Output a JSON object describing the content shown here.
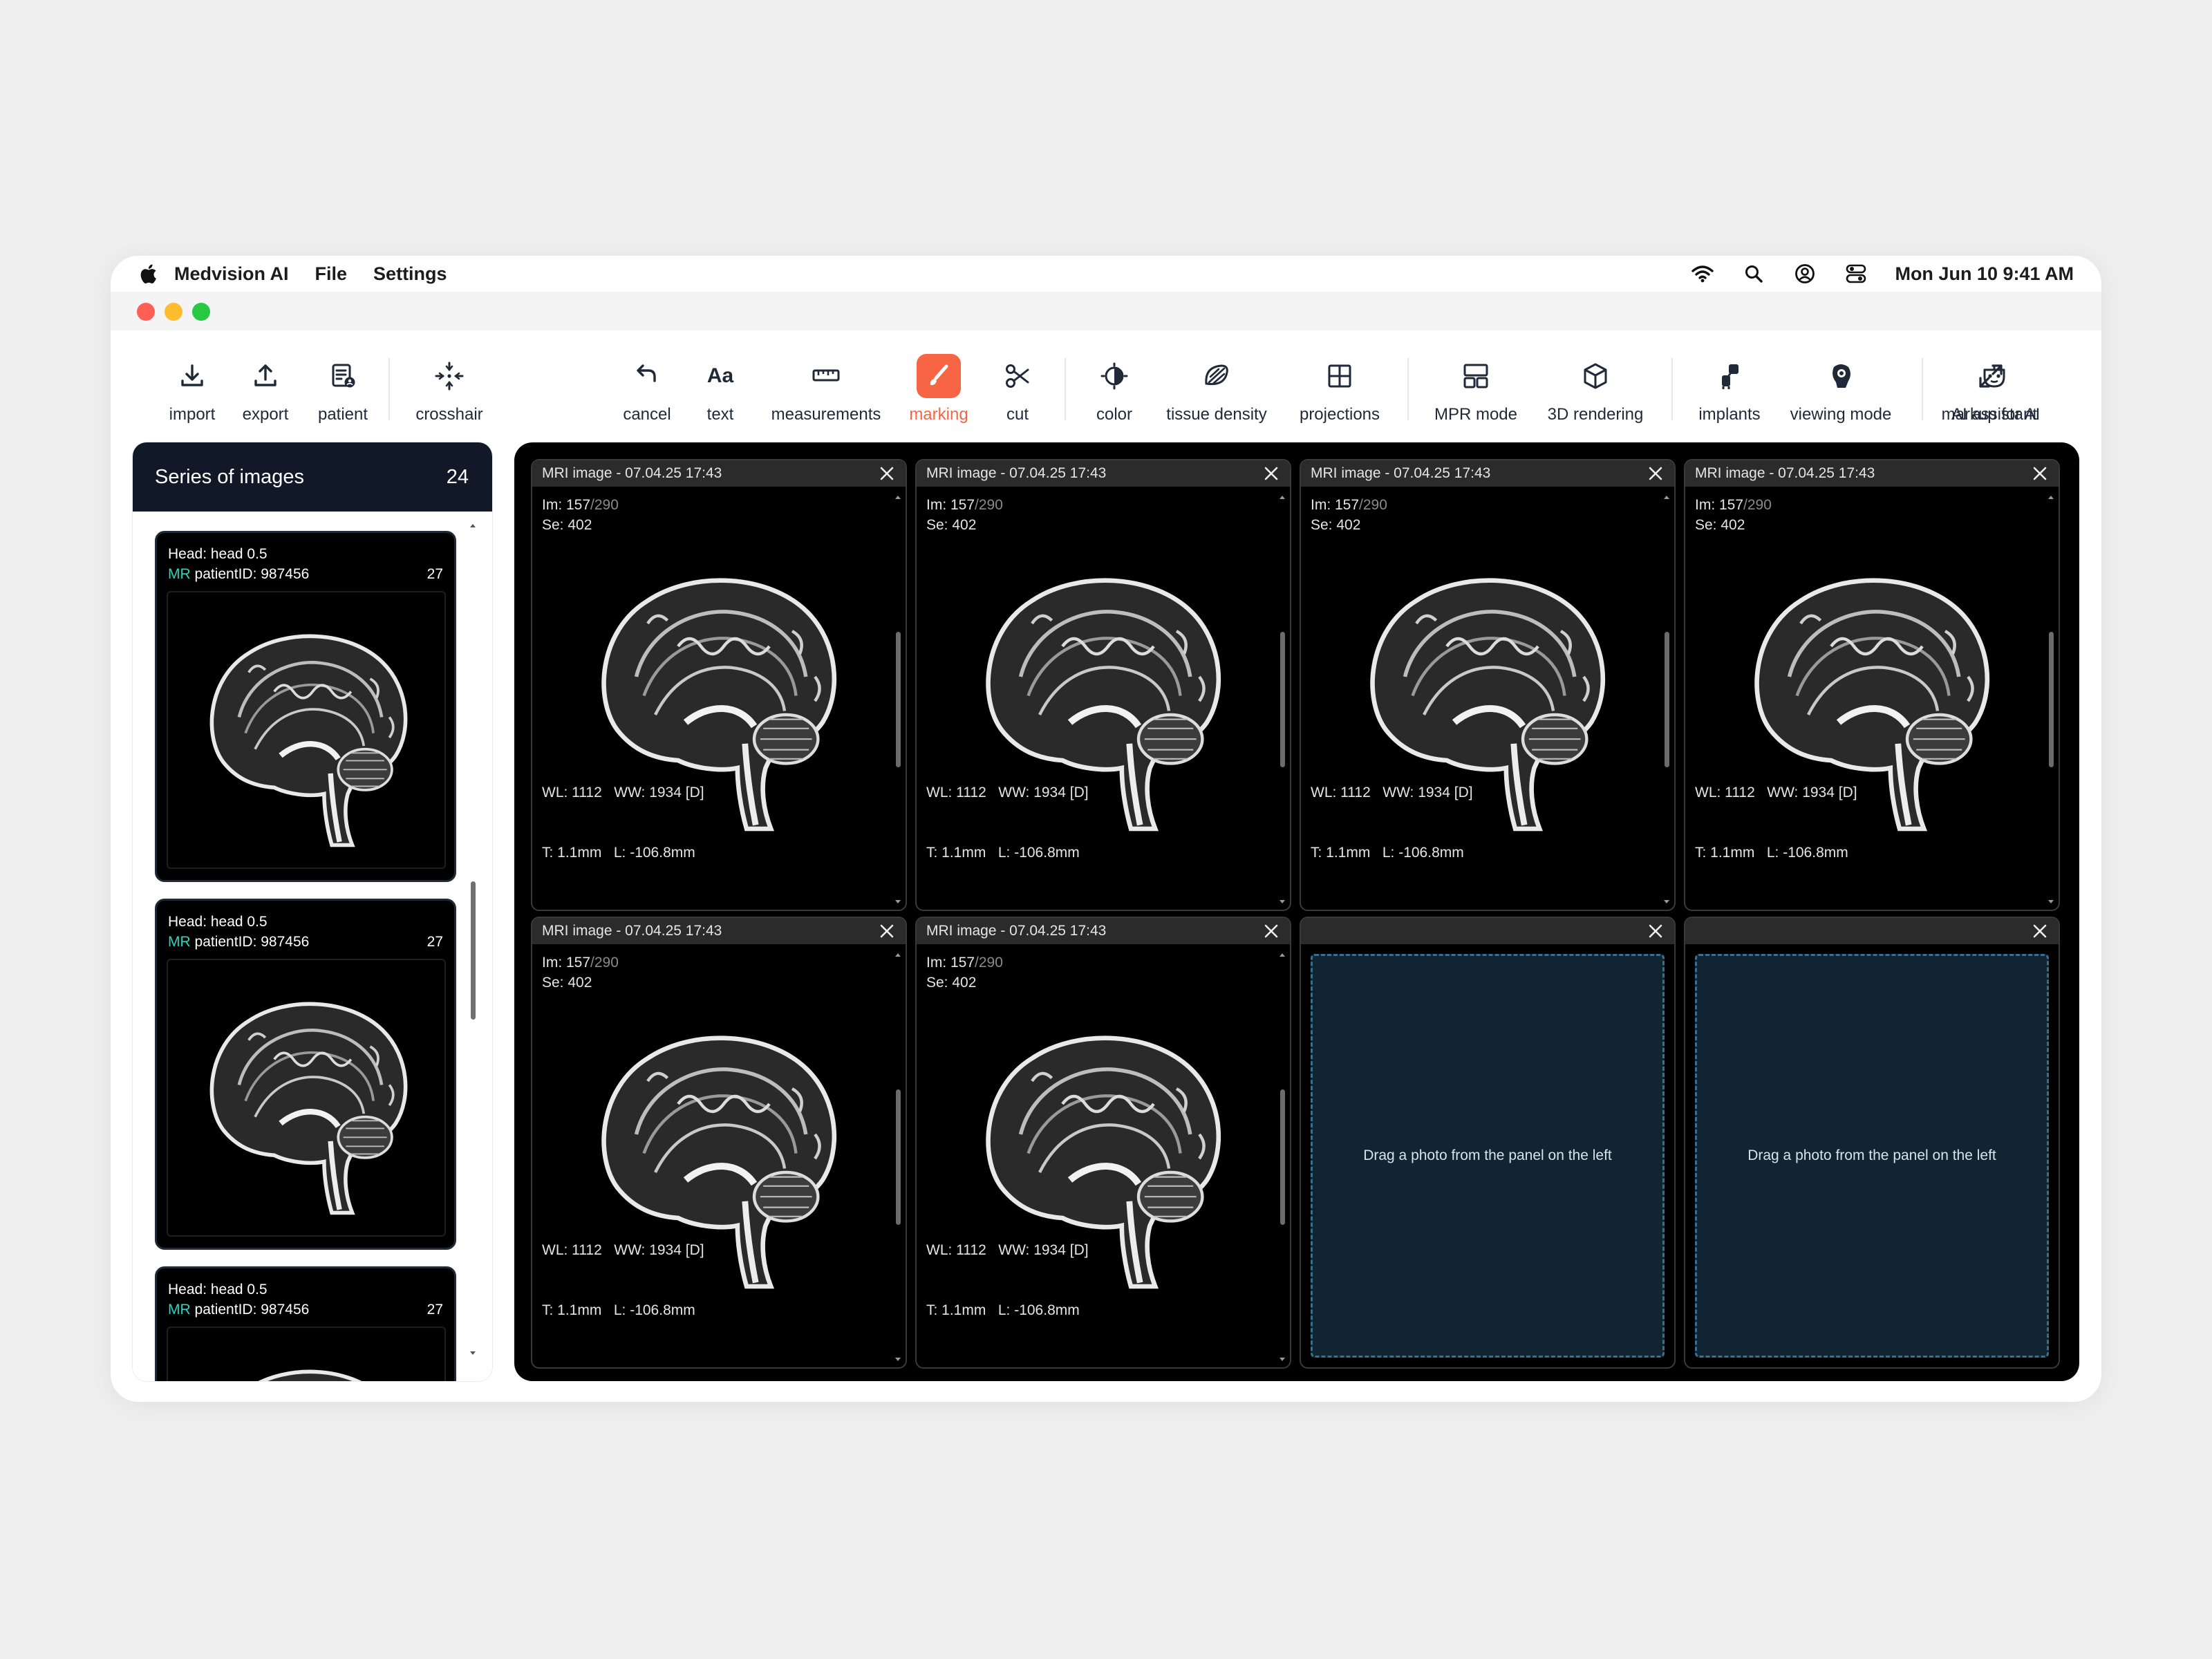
{
  "menubar": {
    "app_name": "Medvision AI",
    "menus": [
      "File",
      "Settings"
    ],
    "clock": "Mon Jun 10  9:41 AM",
    "status_icons": [
      "wifi-icon",
      "search-icon",
      "user-icon",
      "control-center-icon"
    ]
  },
  "window": {
    "traffic_lights": {
      "close": "#ff5f57",
      "minimize": "#febc2e",
      "zoom": "#28c840"
    }
  },
  "toolbar": {
    "accent": "#f76544",
    "items": [
      {
        "label": "import",
        "icon": "import-icon"
      },
      {
        "label": "export",
        "icon": "export-icon"
      },
      {
        "label": "patient",
        "icon": "patient-icon"
      },
      {
        "label": "crosshair",
        "icon": "crosshair-icon"
      },
      {
        "label": "cancel",
        "icon": "cancel-icon"
      },
      {
        "label": "text",
        "icon": "text-icon",
        "glyph": "Aa"
      },
      {
        "label": "measurements",
        "icon": "ruler-icon"
      },
      {
        "label": "marking",
        "icon": "brush-icon",
        "active": true
      },
      {
        "label": "cut",
        "icon": "scissors-icon"
      },
      {
        "label": "color",
        "icon": "color-icon"
      },
      {
        "label": "tissue density",
        "icon": "tissue-density-icon"
      },
      {
        "label": "projections",
        "icon": "projections-icon"
      },
      {
        "label": "MPR mode",
        "icon": "mpr-mode-icon"
      },
      {
        "label": "3D rendering",
        "icon": "cube-icon"
      },
      {
        "label": "implants",
        "icon": "implants-icon"
      },
      {
        "label": "viewing mode",
        "icon": "viewing-mode-icon"
      },
      {
        "label": "AI assistant",
        "icon": "ai-assistant-icon"
      },
      {
        "label": "markup for AI",
        "icon": "expand-icon"
      }
    ]
  },
  "series_panel": {
    "title": "Series of images",
    "count": "24",
    "items": [
      {
        "head": "Head:  head 0.5",
        "modality": "MR",
        "patient": "patientID: 987456",
        "count": "27"
      },
      {
        "head": "Head:  head 0.5",
        "modality": "MR",
        "patient": "patientID: 987456",
        "count": "27"
      },
      {
        "head": "Head:  head 0.5",
        "modality": "MR",
        "patient": "patientID: 987456",
        "count": "27"
      }
    ]
  },
  "viewer": {
    "cells": [
      {
        "title": "MRI image - 07.04.25 17:43",
        "im": "Im: 157",
        "im_total": "/290",
        "se": "Se: 402",
        "wl_ww": "WL: 1112   WW: 1934 [D]",
        "t_l": "T: 1.1mm   L: -106.8mm"
      },
      {
        "title": "MRI image - 07.04.25 17:43",
        "im": "Im: 157",
        "im_total": "/290",
        "se": "Se: 402",
        "wl_ww": "WL: 1112   WW: 1934 [D]",
        "t_l": "T: 1.1mm   L: -106.8mm"
      },
      {
        "title": "MRI image - 07.04.25 17:43",
        "im": "Im: 157",
        "im_total": "/290",
        "se": "Se: 402",
        "wl_ww": "WL: 1112   WW: 1934 [D]",
        "t_l": "T: 1.1mm   L: -106.8mm"
      },
      {
        "title": "MRI image - 07.04.25 17:43",
        "im": "Im: 157",
        "im_total": "/290",
        "se": "Se: 402",
        "wl_ww": "WL: 1112   WW: 1934 [D]",
        "t_l": "T: 1.1mm   L: -106.8mm"
      },
      {
        "title": "MRI image - 07.04.25 17:43",
        "im": "Im: 157",
        "im_total": "/290",
        "se": "Se: 402",
        "wl_ww": "WL: 1112   WW: 1934 [D]",
        "t_l": "T: 1.1mm   L: -106.8mm"
      },
      {
        "title": "MRI image - 07.04.25 17:43",
        "im": "Im: 157",
        "im_total": "/290",
        "se": "Se: 402",
        "wl_ww": "WL: 1112   WW: 1934 [D]",
        "t_l": "T: 1.1mm   L: -106.8mm"
      }
    ],
    "empty_cells": [
      {
        "message": "Drag a photo from the panel on the left"
      },
      {
        "message": "Drag a photo from the panel on the left"
      }
    ]
  }
}
